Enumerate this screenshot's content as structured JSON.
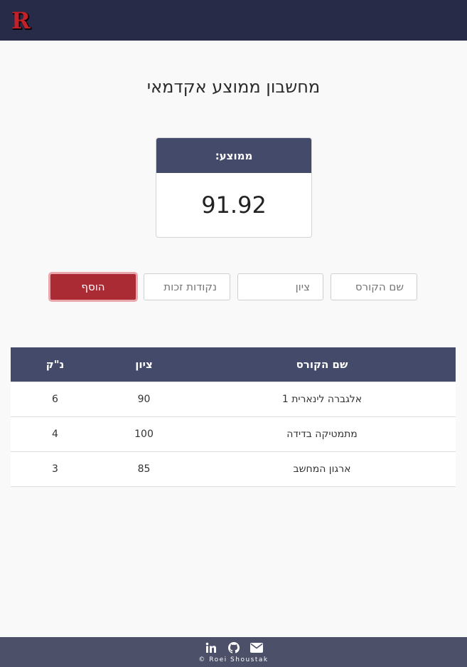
{
  "header": {
    "logo_letter": "R",
    "logo_icon": "r-logo-icon"
  },
  "page": {
    "title": "מחשבון ממוצע אקדמאי"
  },
  "average": {
    "label": "ממוצע:",
    "value": "91.92"
  },
  "form": {
    "course_name_placeholder": "שם הקורס",
    "grade_placeholder": "ציון",
    "credits_placeholder": "נקודות זכות",
    "add_label": "הוסף"
  },
  "table": {
    "headers": {
      "course": "שם הקורס",
      "grade": "ציון",
      "credits": "נ\"ק"
    },
    "rows": [
      {
        "course": "אלגברה לינארית 1",
        "grade": "90",
        "credits": "6"
      },
      {
        "course": "מתמטיקה בדידה",
        "grade": "100",
        "credits": "4"
      },
      {
        "course": "ארגון המחשב",
        "grade": "85",
        "credits": "3"
      }
    ]
  },
  "footer": {
    "icons": [
      "linkedin-icon",
      "github-icon",
      "mail-icon"
    ],
    "copyright": "© Roei Shoustak"
  },
  "colors": {
    "navbar": "#272b48",
    "header_bg": "#444a6a",
    "add_button": "#ab2b35",
    "footer_bg": "#4c5068"
  }
}
